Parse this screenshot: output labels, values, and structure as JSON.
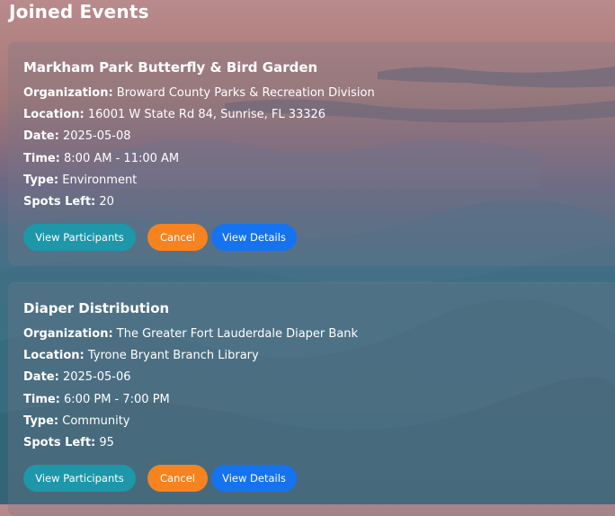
{
  "page": {
    "title": "Joined Events"
  },
  "labels": {
    "organization": "Organization:",
    "location": "Location:",
    "date": "Date:",
    "time": "Time:",
    "type": "Type:",
    "spots_left": "Spots Left:"
  },
  "buttons": {
    "view_participants": "View Participants",
    "cancel": "Cancel",
    "view_details": "View Details"
  },
  "colors": {
    "view_participants_button": "#1d97a9",
    "cancel_button": "#f6831f",
    "view_details_button": "#1573ef"
  },
  "events": [
    {
      "title": "Markham Park Butterfly & Bird Garden",
      "organization": "Broward County Parks & Recreation Division",
      "location": "16001 W State Rd 84, Sunrise, FL 33326",
      "date": "2025-05-08",
      "time": "8:00 AM - 11:00 AM",
      "type": "Environment",
      "spots_left": "20"
    },
    {
      "title": "Diaper Distribution",
      "organization": "The Greater Fort Lauderdale Diaper Bank",
      "location": "Tyrone Bryant Branch Library",
      "date": "2025-05-06",
      "time": "6:00 PM - 7:00 PM",
      "type": "Community",
      "spots_left": "95"
    }
  ]
}
